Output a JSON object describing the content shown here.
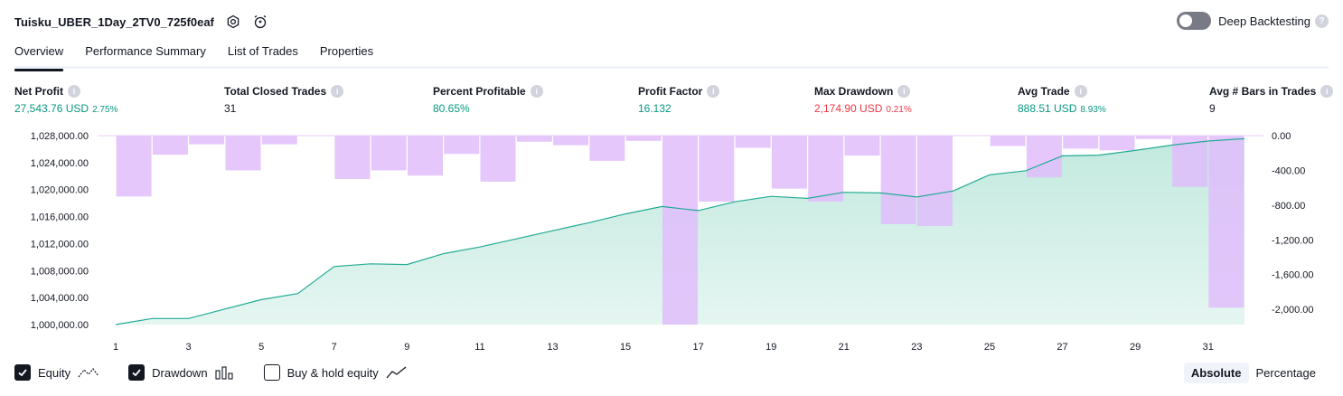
{
  "header": {
    "title": "Tuisku_UBER_1Day_2TV0_725f0eaf",
    "deep_backtesting_label": "Deep Backtesting"
  },
  "tabs": [
    {
      "label": "Overview",
      "active": true
    },
    {
      "label": "Performance Summary",
      "active": false
    },
    {
      "label": "List of Trades",
      "active": false
    },
    {
      "label": "Properties",
      "active": false
    }
  ],
  "metrics": {
    "net_profit": {
      "label": "Net Profit",
      "value": "27,543.76 USD",
      "pct": "2.75%"
    },
    "total_closed_trades": {
      "label": "Total Closed Trades",
      "value": "31"
    },
    "percent_profitable": {
      "label": "Percent Profitable",
      "value": "80.65%"
    },
    "profit_factor": {
      "label": "Profit Factor",
      "value": "16.132"
    },
    "max_drawdown": {
      "label": "Max Drawdown",
      "value": "2,174.90 USD",
      "pct": "0.21%"
    },
    "avg_trade": {
      "label": "Avg Trade",
      "value": "888.51 USD",
      "pct": "8.93%"
    },
    "avg_bars": {
      "label": "Avg # Bars in Trades",
      "value": "9"
    }
  },
  "legend": {
    "equity": {
      "label": "Equity",
      "checked": true
    },
    "drawdown": {
      "label": "Drawdown",
      "checked": true
    },
    "buy_hold": {
      "label": "Buy & hold equity",
      "checked": false
    }
  },
  "mode": {
    "absolute": "Absolute",
    "percentage": "Percentage",
    "selected": "Absolute"
  },
  "colors": {
    "equity_line": "#22ab94",
    "equity_fill": "#bfe8dd",
    "drawdown_bar": "#e1bdfc",
    "drawdown_overlap": "#c4b3ee",
    "positive": "#089981",
    "negative": "#f23645"
  },
  "chart_data": {
    "type": "line",
    "x": [
      1,
      2,
      3,
      4,
      5,
      6,
      7,
      8,
      9,
      10,
      11,
      12,
      13,
      14,
      15,
      16,
      17,
      18,
      19,
      20,
      21,
      22,
      23,
      24,
      25,
      26,
      27,
      28,
      29,
      30,
      31,
      32
    ],
    "x_tick_labels": [
      "1",
      "3",
      "5",
      "7",
      "9",
      "11",
      "13",
      "15",
      "17",
      "19",
      "21",
      "23",
      "25",
      "27",
      "29",
      "31"
    ],
    "y_left_ticks": [
      "1,028,000.00",
      "1,024,000.00",
      "1,020,000.00",
      "1,016,000.00",
      "1,012,000.00",
      "1,008,000.00",
      "1,004,000.00",
      "1,000,000.00"
    ],
    "y_right_ticks": [
      "0.00",
      "-400.00",
      "-800.00",
      "-1,200.00",
      "-1,600.00",
      "-2,000.00"
    ],
    "ylim_left": [
      1000000,
      1028000
    ],
    "ylim_right": [
      -2175,
      0
    ],
    "series": [
      {
        "name": "Equity",
        "axis": "left",
        "values": [
          1000000,
          1000900,
          1000900,
          1002300,
          1003700,
          1004600,
          1008600,
          1009000,
          1008900,
          1010500,
          1011500,
          1012700,
          1013900,
          1015100,
          1016400,
          1017500,
          1016900,
          1018200,
          1019000,
          1018700,
          1019600,
          1019500,
          1018900,
          1019800,
          1022200,
          1022800,
          1025000,
          1025100,
          1025800,
          1026600,
          1027200,
          1027544
        ]
      },
      {
        "name": "Drawdown",
        "axis": "right",
        "type": "bar",
        "values": [
          0,
          -700,
          -220,
          -100,
          -400,
          -100,
          0,
          -500,
          -400,
          -460,
          -210,
          -530,
          -70,
          -110,
          -290,
          -60,
          -2175,
          -760,
          -140,
          -610,
          -760,
          -230,
          -1020,
          -1040,
          0,
          -120,
          -480,
          -150,
          -170,
          -40,
          -590,
          -1980
        ]
      }
    ]
  }
}
